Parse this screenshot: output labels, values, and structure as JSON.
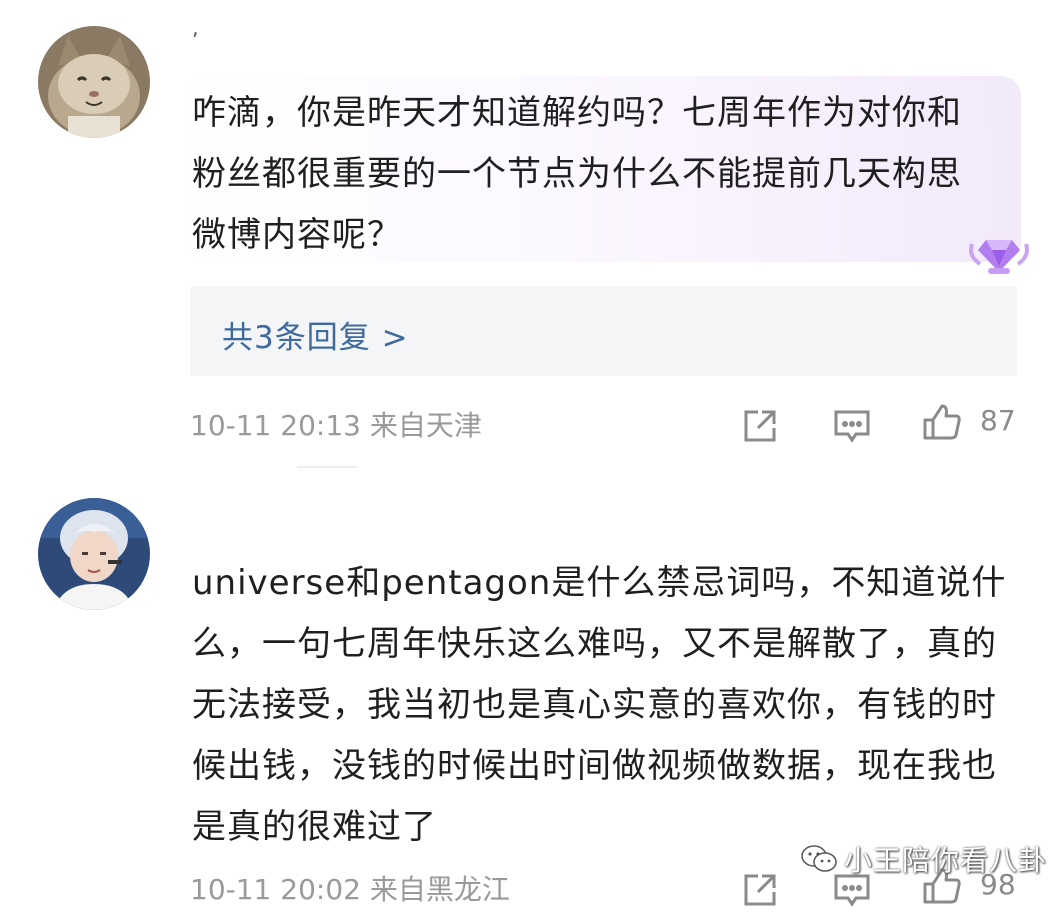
{
  "comments": [
    {
      "username": "ʼ",
      "text": "咋滴，你是昨天才知道解约吗？七周年作为对你和粉丝都很重要的一个节点为什么不能提前几天构思微博内容呢？",
      "replies_label": "共3条回复 >",
      "meta": "10-11 20:13 来自天津",
      "like_count": "87",
      "avatar": "cat-avatar",
      "badge": "purple-gem-badge-icon"
    },
    {
      "text": "universe和pentagon是什么禁忌词吗，不知道说什么，一句七周年快乐这么难吗，又不是解散了，真的无法接受，我当初也是真心实意的喜欢你，有钱的时候出钱，没钱的时候出时间做视频做数据，现在我也是真的很难过了",
      "meta": "10-11 20:02 来自黑龙江",
      "like_count": "98",
      "avatar": "silver-hair-person-avatar"
    }
  ],
  "watermark": {
    "text": "小王陪你看八卦",
    "icon": "wechat-icon"
  },
  "colors": {
    "link": "#3f6a9e",
    "meta": "#9a9a9a",
    "reply_bg": "#f4f5f7"
  }
}
